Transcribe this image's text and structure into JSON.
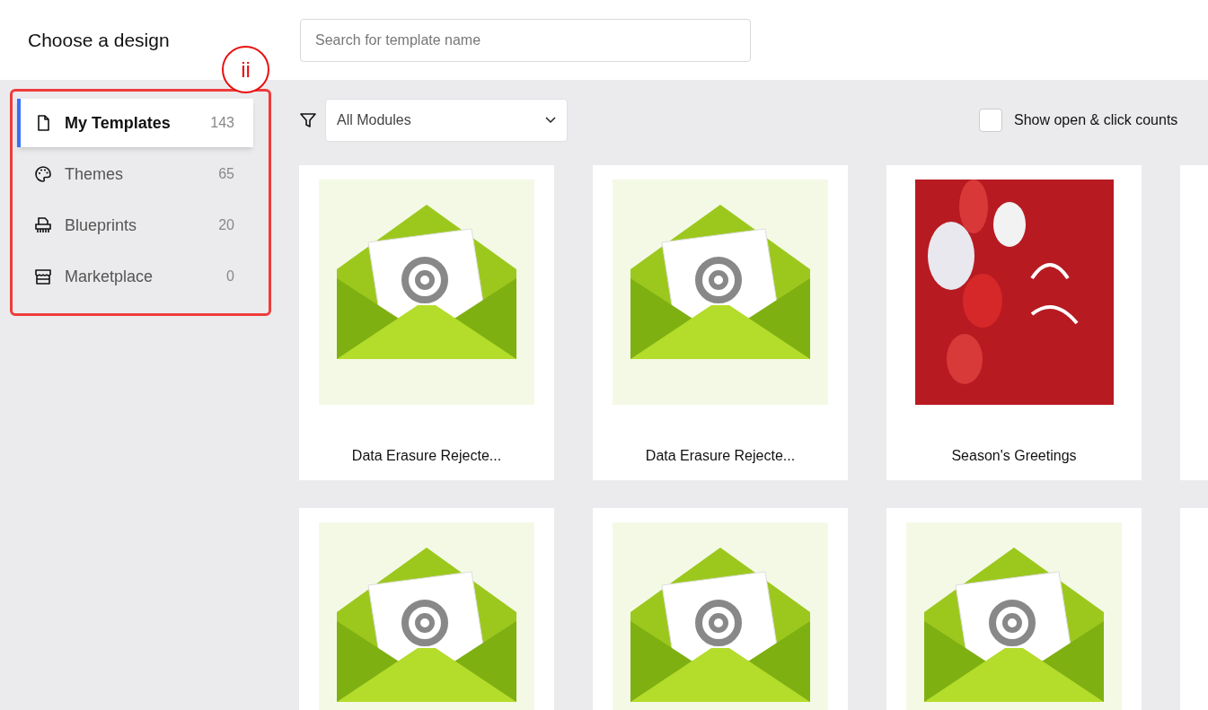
{
  "header": {
    "title": "Choose a design",
    "search": {
      "placeholder": "Search for template name"
    }
  },
  "annotation": {
    "label": "ii"
  },
  "sidebar": {
    "items": [
      {
        "label": "My Templates",
        "count": "143",
        "kind": "file",
        "selected": true
      },
      {
        "label": "Themes",
        "count": "65",
        "kind": "palette",
        "selected": false
      },
      {
        "label": "Blueprints",
        "count": "20",
        "kind": "printer",
        "selected": false
      },
      {
        "label": "Marketplace",
        "count": "0",
        "kind": "store",
        "selected": false
      }
    ]
  },
  "toolbar": {
    "module_filter": {
      "value": "All Modules"
    },
    "show_counts": {
      "label": "Show open & click counts",
      "checked": false
    }
  },
  "cards": [
    {
      "kind": "envelope",
      "title": "Data Erasure Rejecte..."
    },
    {
      "kind": "envelope",
      "title": "Data Erasure Rejecte..."
    },
    {
      "kind": "photo",
      "title": "Season's Greetings"
    },
    {
      "kind": "blank"
    },
    {
      "kind": "envelope"
    },
    {
      "kind": "envelope"
    },
    {
      "kind": "envelope"
    },
    {
      "kind": "blank"
    }
  ]
}
